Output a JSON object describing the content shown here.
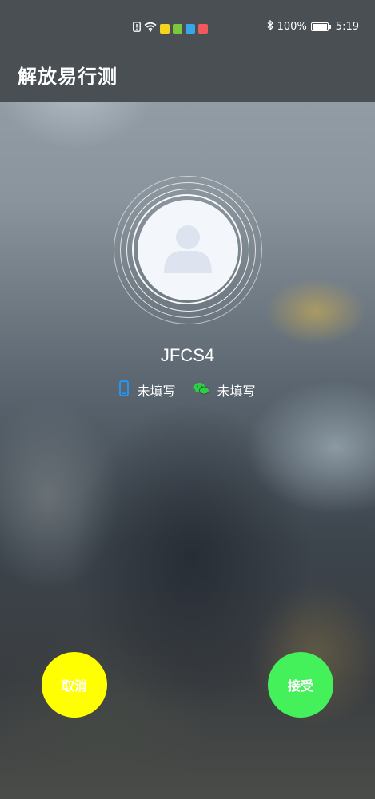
{
  "status_bar": {
    "battery": "100%",
    "time": "5:19",
    "icons": [
      "sim-alert-icon",
      "wifi-icon",
      "app-notification-icon",
      "app-notification-icon",
      "app-notification-icon",
      "app-notification-icon",
      "bluetooth-icon",
      "battery-icon"
    ]
  },
  "header": {
    "title": "解放易行测"
  },
  "caller": {
    "name": "JFCS4",
    "phone_label": "未填写",
    "wechat_label": "未填写"
  },
  "actions": {
    "cancel_label": "取消",
    "accept_label": "接受"
  },
  "colors": {
    "cancel": "#ffff00",
    "accept": "#44f15a",
    "bar": "#4a4f54",
    "phone_icon": "#1e9bff",
    "wechat_icon": "#2ad142"
  }
}
